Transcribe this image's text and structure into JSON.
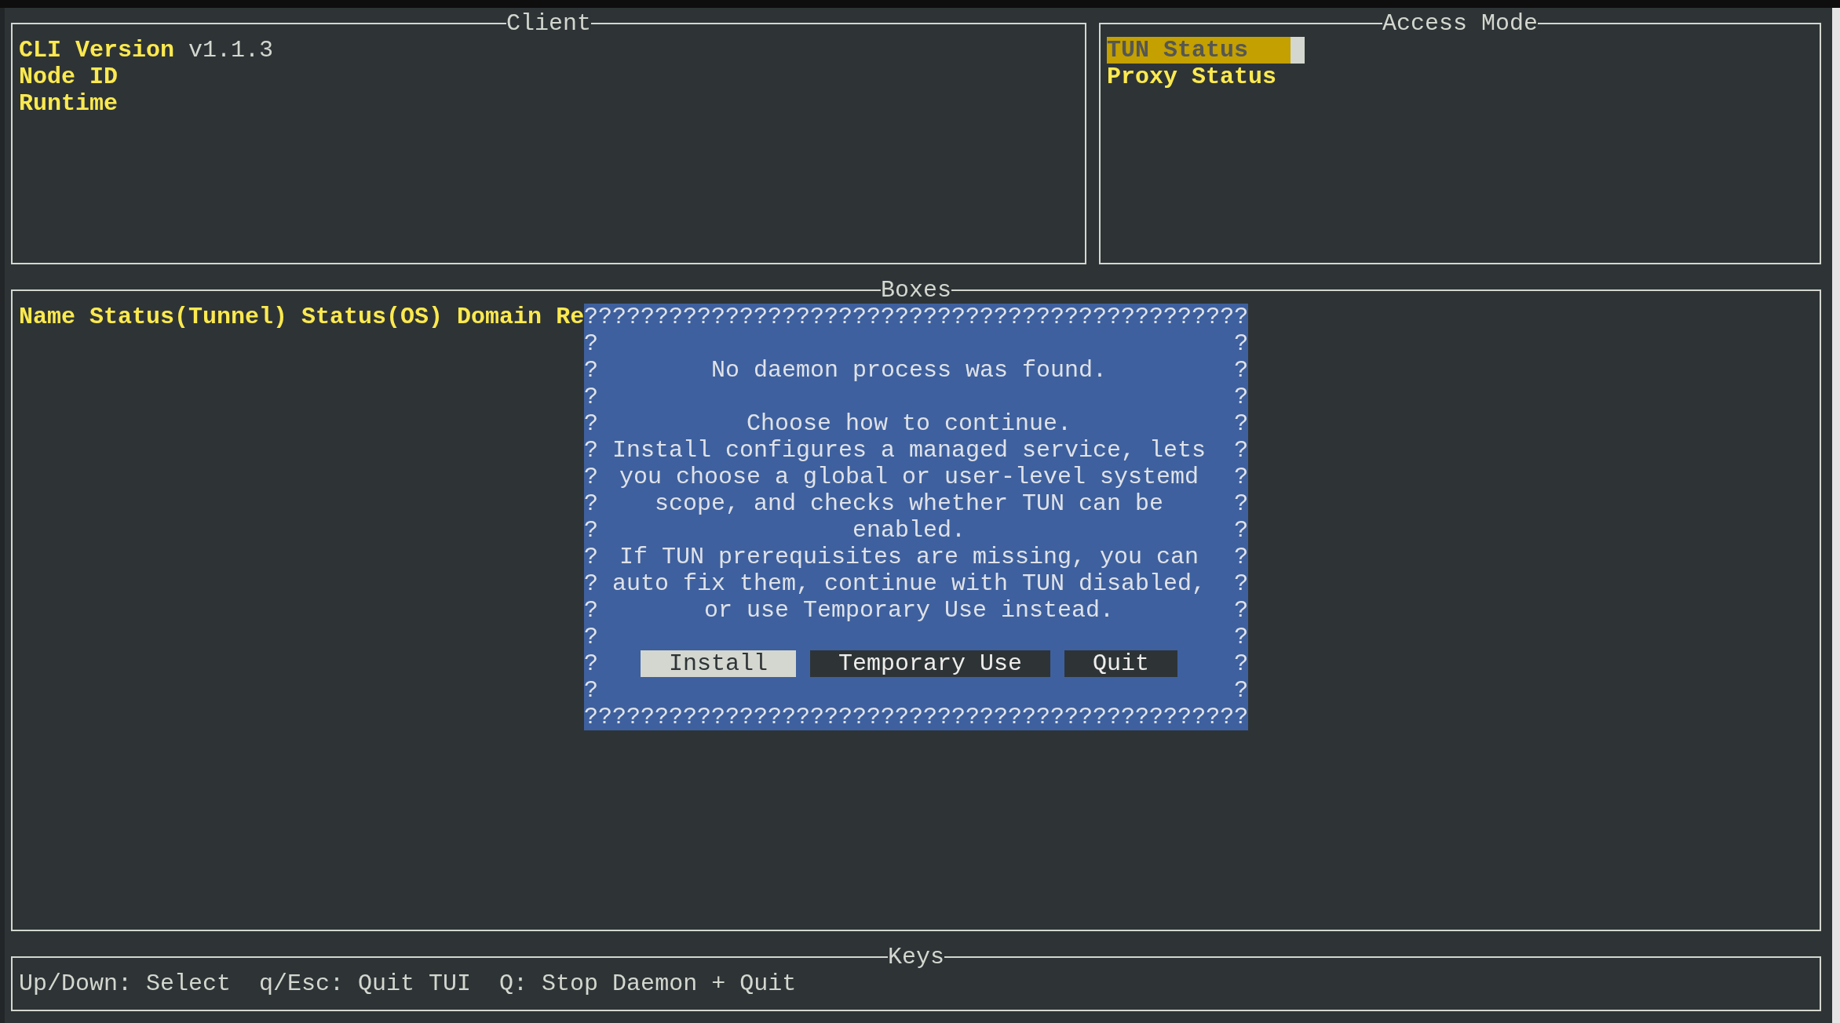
{
  "client": {
    "title": "Client",
    "fields": [
      {
        "label": "CLI Version",
        "value": "v1.1.3"
      },
      {
        "label": "Node ID"
      },
      {
        "label": "Runtime"
      }
    ]
  },
  "access_mode": {
    "title": "Access Mode",
    "items": [
      {
        "label": "TUN Status",
        "selected": true
      },
      {
        "label": "Proxy Status",
        "selected": false
      }
    ]
  },
  "boxes": {
    "title": "Boxes",
    "columns": [
      "Name",
      "Status(Tunnel)",
      "Status(OS)",
      "Domain",
      "Re"
    ]
  },
  "dialog": {
    "border_top": "???????????????????????????????????????????????",
    "border_left": "??????????????",
    "headline": "No daemon process was found.",
    "lines": [
      "Choose how to continue.",
      "Install configures a managed service, lets you choose a global or user-level systemd scope, and checks whether TUN can be enabled.",
      "If TUN prerequisites are missing, you can auto fix them, continue with TUN disabled, or use Temporary Use instead."
    ],
    "buttons": [
      {
        "label": "Install",
        "selected": true
      },
      {
        "label": "Temporary Use",
        "selected": false
      },
      {
        "label": "Quit",
        "selected": false
      }
    ],
    "border_right": "??????????????",
    "border_bottom": "???????????????????????????????????????????????"
  },
  "keys": {
    "title": "Keys",
    "hints": [
      "Up/Down: Select",
      "q/Esc: Quit TUI",
      "Q: Stop Daemon + Quit"
    ]
  }
}
